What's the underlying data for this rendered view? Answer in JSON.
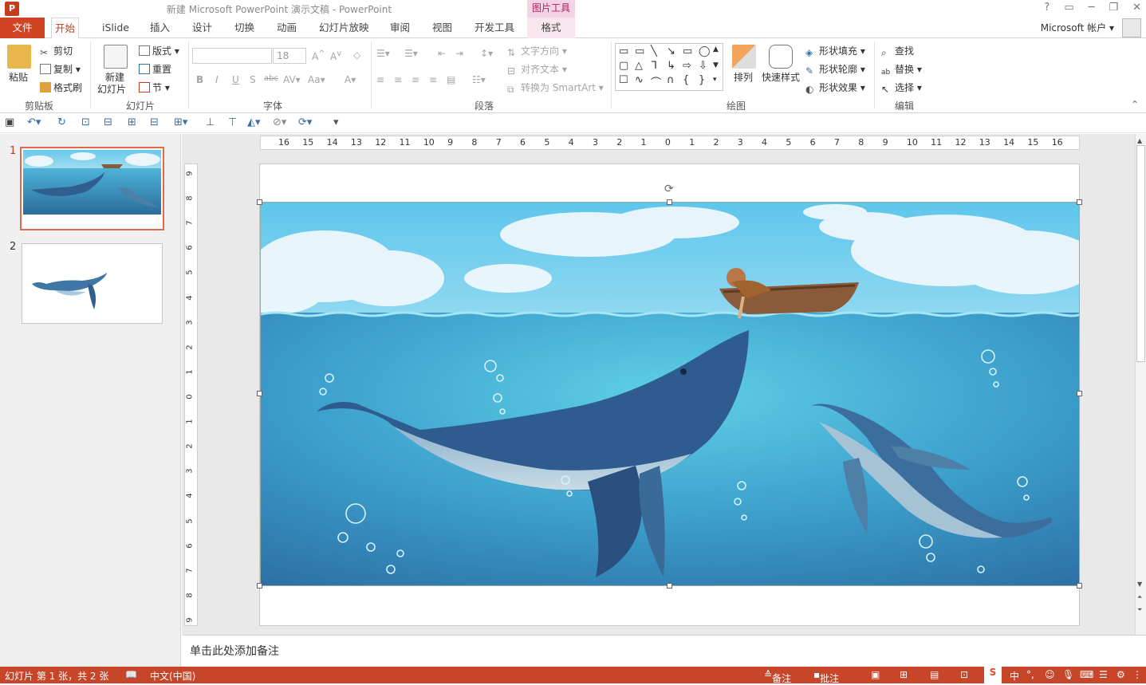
{
  "window": {
    "title": "新建 Microsoft PowerPoint 演示文稿 - PowerPoint",
    "context_tool": "图片工具",
    "controls": [
      "?",
      "▭",
      "─",
      "❐",
      "✕"
    ]
  },
  "tabs": [
    "文件",
    "开始",
    "iSlide",
    "插入",
    "设计",
    "切换",
    "动画",
    "幻灯片放映",
    "审阅",
    "视图",
    "开发工具",
    "格式"
  ],
  "account": "Microsoft 帐户",
  "ribbon": {
    "clipboard": {
      "label": "剪贴板",
      "paste": "粘贴",
      "cut": "剪切",
      "copy": "复制",
      "format_painter": "格式刷"
    },
    "slides": {
      "label": "幻灯片",
      "new_slide_line1": "新建",
      "new_slide_line2": "幻灯片",
      "layout": "版式",
      "reset": "重置",
      "section": "节"
    },
    "font": {
      "label": "字体",
      "font_name": "",
      "font_size": "18"
    },
    "paragraph": {
      "label": "段落",
      "text_direction": "文字方向",
      "align_text": "对齐文本",
      "convert_smartart": "转换为 SmartArt"
    },
    "drawing": {
      "label": "绘图",
      "arrange": "排列",
      "quick_styles": "快速样式",
      "shape_fill": "形状填充",
      "shape_outline": "形状轮廓",
      "shape_effects": "形状效果"
    },
    "editing": {
      "label": "编辑",
      "find": "查找",
      "replace": "替换",
      "select": "选择"
    }
  },
  "thumbnails": [
    {
      "number": "1",
      "selected": true
    },
    {
      "number": "2",
      "selected": false
    }
  ],
  "hruler_ticks": [
    "16",
    "15",
    "14",
    "13",
    "12",
    "11",
    "10",
    "9",
    "8",
    "7",
    "6",
    "5",
    "4",
    "3",
    "2",
    "1",
    "0",
    "1",
    "2",
    "3",
    "4",
    "5",
    "6",
    "7",
    "8",
    "9",
    "10",
    "11",
    "12",
    "13",
    "14",
    "15",
    "16"
  ],
  "vruler_ticks": [
    "9",
    "8",
    "7",
    "6",
    "5",
    "4",
    "3",
    "2",
    "1",
    "0",
    "1",
    "2",
    "3",
    "4",
    "5",
    "6",
    "7",
    "8",
    "9"
  ],
  "notes": {
    "placeholder": "单击此处添加备注"
  },
  "status": {
    "slide_info": "幻灯片 第 1 张，共 2 张",
    "language": "中文(中国)",
    "notes_btn": "备注",
    "comments_btn": "批注",
    "ime": "中"
  },
  "colors": {
    "accent": "#c43e1c",
    "status_bar": "#c7462a",
    "selection": "#e0694a"
  }
}
